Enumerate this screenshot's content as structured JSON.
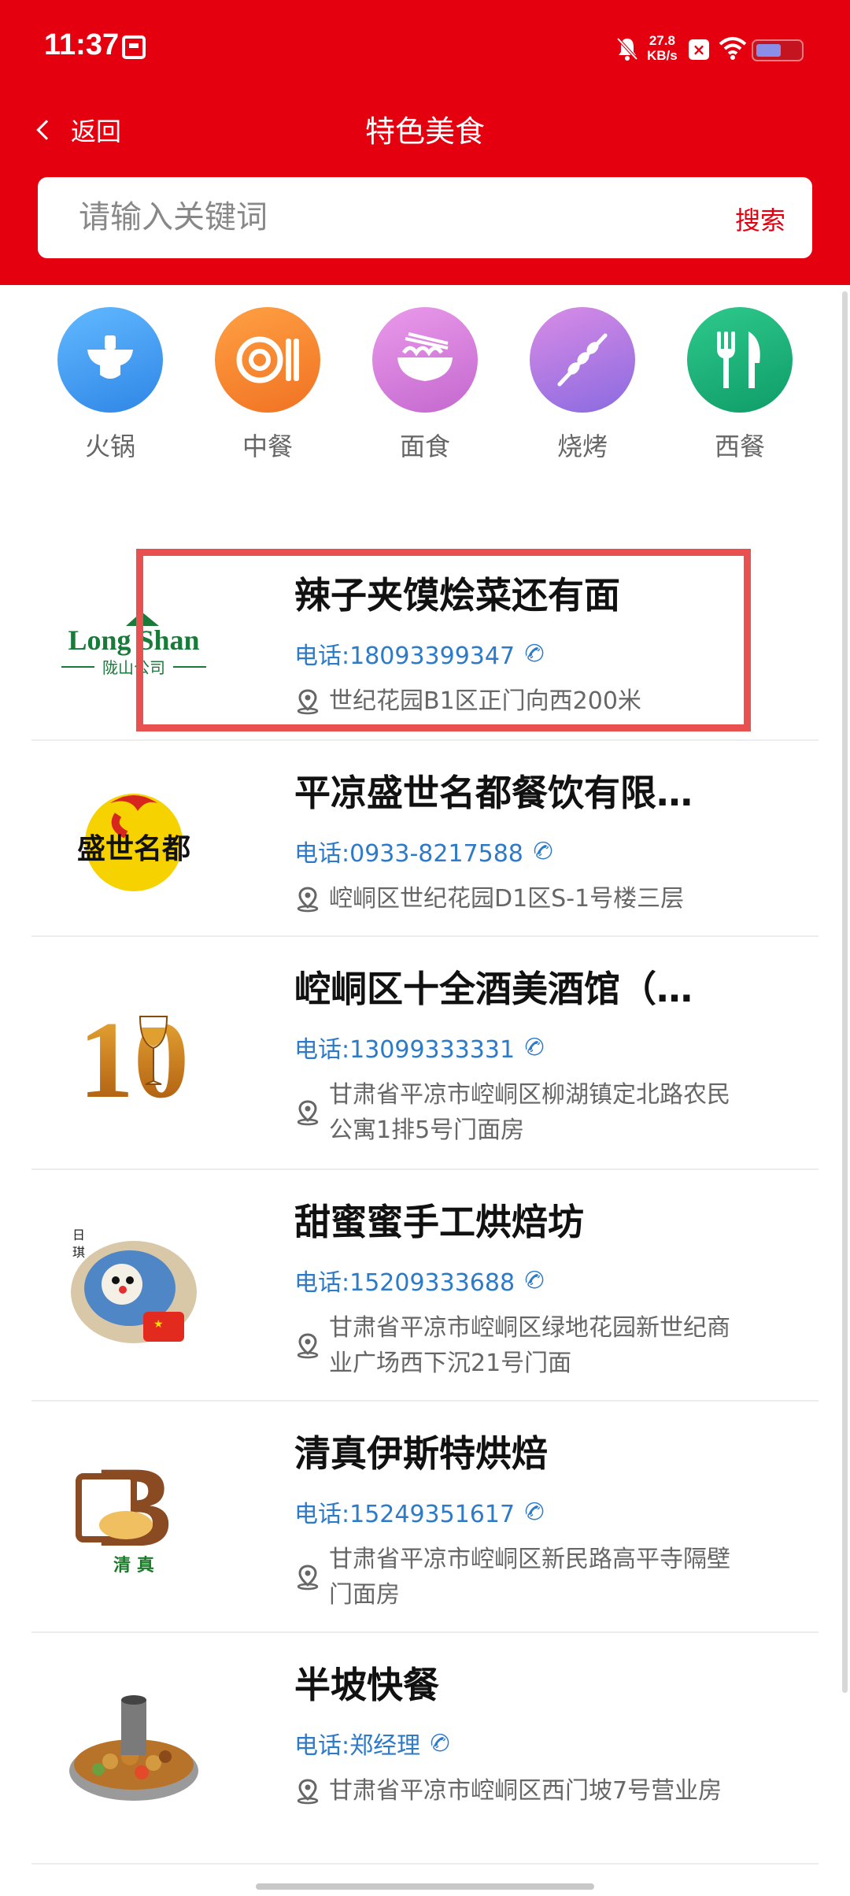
{
  "status_bar": {
    "time": "11:37",
    "speed_value": "27.8",
    "speed_unit": "KB/s",
    "battery_level": 0.55
  },
  "nav": {
    "back_label": "返回",
    "title": "特色美食"
  },
  "search": {
    "placeholder": "请输入关键词",
    "value": "",
    "button_label": "搜索"
  },
  "categories": [
    {
      "label": "火锅",
      "icon": "hotpot-icon",
      "color": "#4aa3f0"
    },
    {
      "label": "中餐",
      "icon": "chinese-food-icon",
      "color": "#f4862a"
    },
    {
      "label": "面食",
      "icon": "noodles-icon",
      "color": "#d77ed8"
    },
    {
      "label": "烧烤",
      "icon": "bbq-icon",
      "color": "#b07ee0"
    },
    {
      "label": "西餐",
      "icon": "western-food-icon",
      "color": "#1cb07a"
    }
  ],
  "restaurants": [
    {
      "name": "辣子夹馍烩菜还有面",
      "phone": "电话:18093399347",
      "address": "世纪花园B1区正门向西200米",
      "logo": "longshan-logo",
      "logo_text_main": "Long Shan",
      "logo_text_sub": "陇山公司"
    },
    {
      "name": "平凉盛世名都餐饮有限…",
      "phone": "电话:0933-8217588",
      "address": "崆峒区世纪花园D1区S-1号楼三层",
      "logo": "shengshi-mingdu-logo",
      "logo_text_main": "盛世名都",
      "logo_text_sub": ""
    },
    {
      "name": "崆峒区十全酒美酒馆（…",
      "phone": "电话:13099333331",
      "address": "甘肃省平凉市崆峒区柳湖镇定北路农民公寓1排5号门面房",
      "logo": "wine-glass-10-logo",
      "logo_text_main": "10",
      "logo_text_sub": ""
    },
    {
      "name": "甜蜜蜜手工烘焙坊",
      "phone": "电话:15209333688",
      "address": "甘肃省平凉市崆峒区绿地花园新世纪商业广场西下沉21号门面",
      "logo": "cake-photo",
      "logo_text_main": "",
      "logo_text_sub": ""
    },
    {
      "name": "清真伊斯特烘焙",
      "phone": "电话:15249351617",
      "address": "甘肃省平凉市崆峒区新民路高平寺隔壁门面房",
      "logo": "bakery-b-logo",
      "logo_text_main": "B",
      "logo_text_sub": "清 真"
    },
    {
      "name": "半坡快餐",
      "phone": "电话:郑经理",
      "address": "甘肃省平凉市崆峒区西门坡7号营业房",
      "logo": "dry-pot-dish-photo",
      "logo_text_main": "",
      "logo_text_sub": ""
    }
  ],
  "colors": {
    "brand_red": "#e5000f",
    "phone_blue": "#2d7ac9",
    "highlight": "#e8514f"
  }
}
